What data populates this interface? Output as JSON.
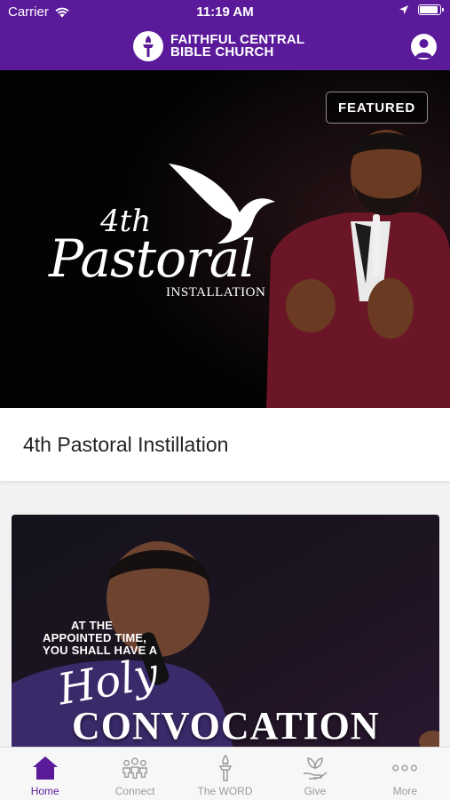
{
  "status_bar": {
    "carrier": "Carrier",
    "time": "11:19 AM",
    "battery_level": 0.95
  },
  "header": {
    "title_line1": "FAITHFUL CENTRAL",
    "title_line2": "BIBLE CHURCH"
  },
  "featured": {
    "badge": "FEATURED",
    "art_number": "4th",
    "art_script": "Pastoral",
    "art_subtitle": "INSTALLATION",
    "caption": "4th Pastoral Instillation"
  },
  "second_card": {
    "line1": "AT THE",
    "line2": "APPOINTED TIME,",
    "line3": "YOU SHALL HAVE A",
    "script": "Holy",
    "title": "CONVOCATION"
  },
  "tabs": [
    {
      "label": "Home",
      "icon": "home-icon",
      "active": true
    },
    {
      "label": "Connect",
      "icon": "people-icon",
      "active": false
    },
    {
      "label": "The WORD",
      "icon": "torch-icon",
      "active": false
    },
    {
      "label": "Give",
      "icon": "give-hand-icon",
      "active": false
    },
    {
      "label": "More",
      "icon": "more-dots-icon",
      "active": false
    }
  ],
  "colors": {
    "brand": "#5a1a9a",
    "tab_inactive": "#9a9a9a"
  }
}
